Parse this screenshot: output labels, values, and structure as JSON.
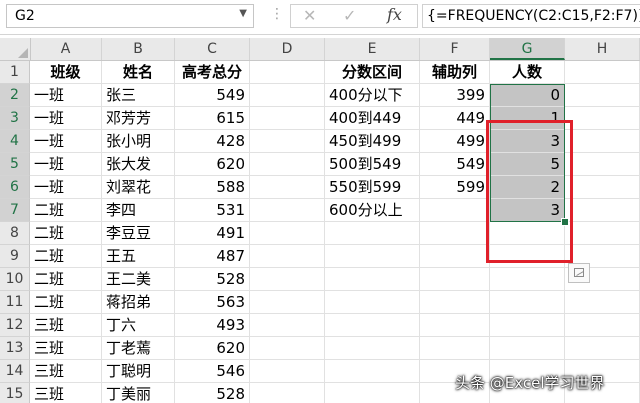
{
  "formula_bar": {
    "name_box": "G2",
    "name_box_arrow": "▼",
    "grip": "⋮",
    "cancel_icon": "✕",
    "enter_icon": "✓",
    "fx_label": "fx",
    "formula": "{=FREQUENCY(C2:C15,F2:F7)}"
  },
  "columns": [
    "A",
    "B",
    "C",
    "D",
    "E",
    "F",
    "G",
    "H"
  ],
  "rows": [
    "1",
    "2",
    "3",
    "4",
    "5",
    "6",
    "7",
    "8",
    "9",
    "10",
    "11",
    "12",
    "13",
    "14",
    "15"
  ],
  "sheet": {
    "headers": {
      "A": "班级",
      "B": "姓名",
      "C": "高考总分",
      "E": "分数区间",
      "F": "辅助列",
      "G": "人数"
    },
    "students": [
      {
        "class": "一班",
        "name": "张三",
        "score": "549"
      },
      {
        "class": "一班",
        "name": "邓芳芳",
        "score": "615"
      },
      {
        "class": "一班",
        "name": "张小明",
        "score": "428"
      },
      {
        "class": "一班",
        "name": "张大发",
        "score": "620"
      },
      {
        "class": "一班",
        "name": "刘翠花",
        "score": "588"
      },
      {
        "class": "二班",
        "name": "李四",
        "score": "531"
      },
      {
        "class": "二班",
        "name": "李豆豆",
        "score": "491"
      },
      {
        "class": "二班",
        "name": "王五",
        "score": "487"
      },
      {
        "class": "二班",
        "name": "王二美",
        "score": "528"
      },
      {
        "class": "二班",
        "name": "蒋招弟",
        "score": "563"
      },
      {
        "class": "三班",
        "name": "丁六",
        "score": "493"
      },
      {
        "class": "三班",
        "name": "丁老蔫",
        "score": "620"
      },
      {
        "class": "三班",
        "name": "丁聪明",
        "score": "546"
      },
      {
        "class": "三班",
        "name": "丁美丽",
        "score": "528"
      }
    ],
    "intervals": [
      "400分以下",
      "400到449",
      "450到499",
      "500到549",
      "550到599",
      "600分以上"
    ],
    "helper": [
      "399",
      "449",
      "499",
      "549",
      "599",
      ""
    ],
    "counts": [
      "0",
      "1",
      "3",
      "5",
      "2",
      "3"
    ]
  },
  "watermark": "头条 @Excel学习世界",
  "colors": {
    "selection_border": "#217346",
    "highlight_box": "#e0202a",
    "selected_fill": "#c4c4c4"
  }
}
